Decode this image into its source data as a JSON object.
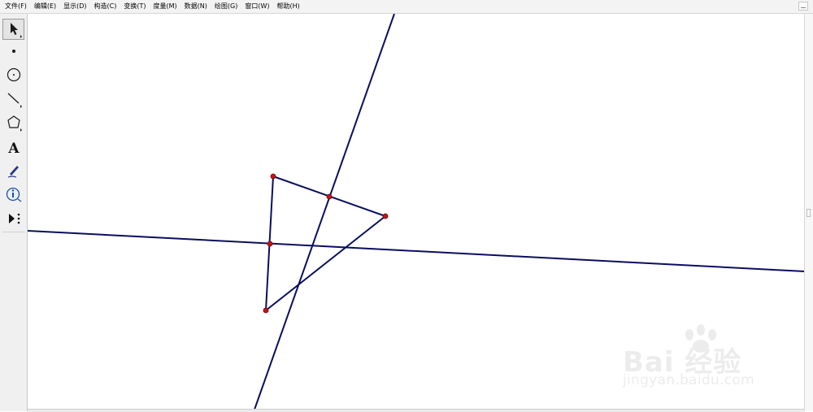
{
  "menu": [
    {
      "label": "文件(F)"
    },
    {
      "label": "编辑(E)"
    },
    {
      "label": "显示(D)"
    },
    {
      "label": "构造(C)"
    },
    {
      "label": "变换(T)"
    },
    {
      "label": "度量(M)"
    },
    {
      "label": "数据(N)"
    },
    {
      "label": "绘图(G)"
    },
    {
      "label": "窗口(W)"
    },
    {
      "label": "帮助(H)"
    }
  ],
  "tools": [
    {
      "name": "arrow-select-tool-icon",
      "active": true
    },
    {
      "name": "point-tool-icon"
    },
    {
      "name": "compass-tool-icon"
    },
    {
      "name": "straightedge-tool-icon"
    },
    {
      "name": "polygon-tool-icon"
    },
    {
      "name": "text-tool-icon"
    },
    {
      "name": "marker-tool-icon"
    },
    {
      "name": "information-tool-icon"
    },
    {
      "name": "custom-tool-icon"
    }
  ],
  "text_tool_glyph": "A",
  "colors": {
    "line": "#0a0e5e",
    "point_fill": "#c21414",
    "point_stroke": "#7a0000",
    "watermark": "#ececec"
  },
  "watermark": {
    "brand": "Bai 经验",
    "url": "jingyan.baidu.com"
  }
}
